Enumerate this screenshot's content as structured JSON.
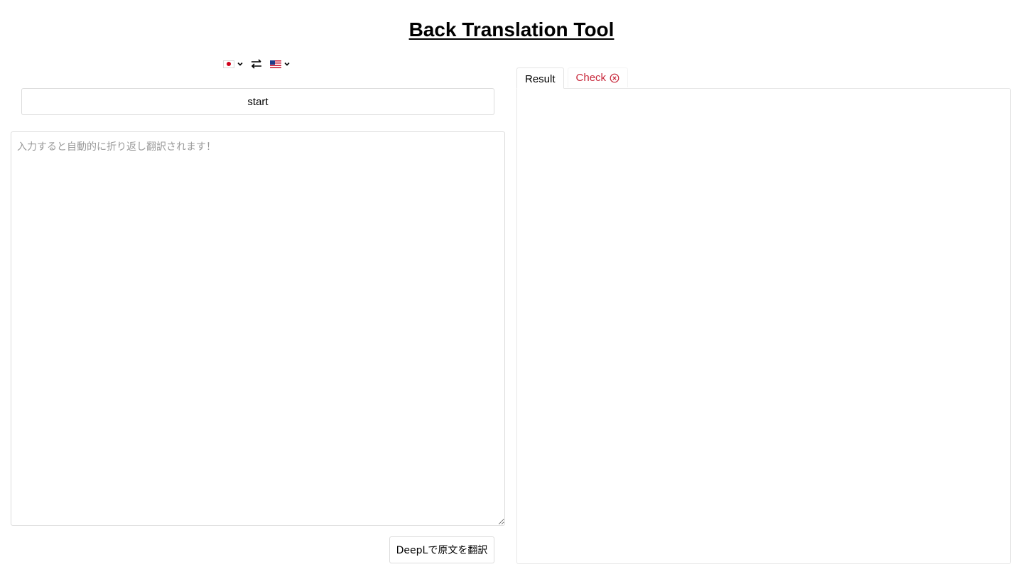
{
  "header": {
    "title": "Back Translation Tool"
  },
  "language_bar": {
    "source_flag_icon": "japan-flag-icon",
    "target_flag_icon": "us-flag-icon",
    "swap_icon": "swap-arrows-icon"
  },
  "start_button": {
    "label": "start"
  },
  "source_input": {
    "value": "",
    "placeholder": "入力すると自動的に折り返し翻訳されます！"
  },
  "deepl_button": {
    "label": "DeepLで原文を翻訳"
  },
  "tabs": [
    {
      "label": "Result",
      "active": true
    },
    {
      "label": "Check",
      "icon": "x-circle-icon",
      "color": "#c8283b"
    }
  ],
  "result": {
    "text": ""
  }
}
